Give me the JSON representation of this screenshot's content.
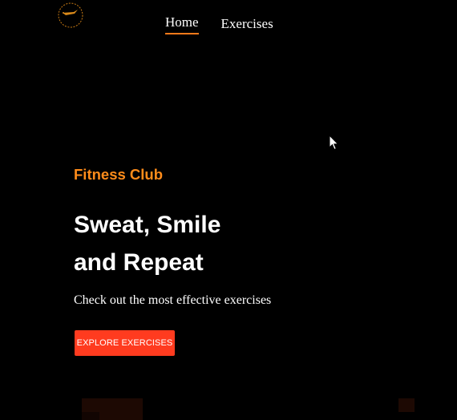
{
  "header": {
    "logo_icon": "gym-badge-logo-icon",
    "nav": [
      {
        "label": "Home",
        "active": true
      },
      {
        "label": "Exercises",
        "active": false
      }
    ]
  },
  "hero": {
    "kicker": "Fitness Club",
    "title_line1": "Sweat, Smile",
    "title_line2": "and Repeat",
    "subtitle": "Check out the most effective exercises",
    "cta_label": "EXPLORE EXERCISES"
  },
  "colors": {
    "background": "#000000",
    "accent_orange": "#ff8c1a",
    "nav_underline": "#ff7a1a",
    "cta_red": "#ff3b1f",
    "text": "#ffffff"
  },
  "cursor_icon": "mouse-pointer-icon"
}
